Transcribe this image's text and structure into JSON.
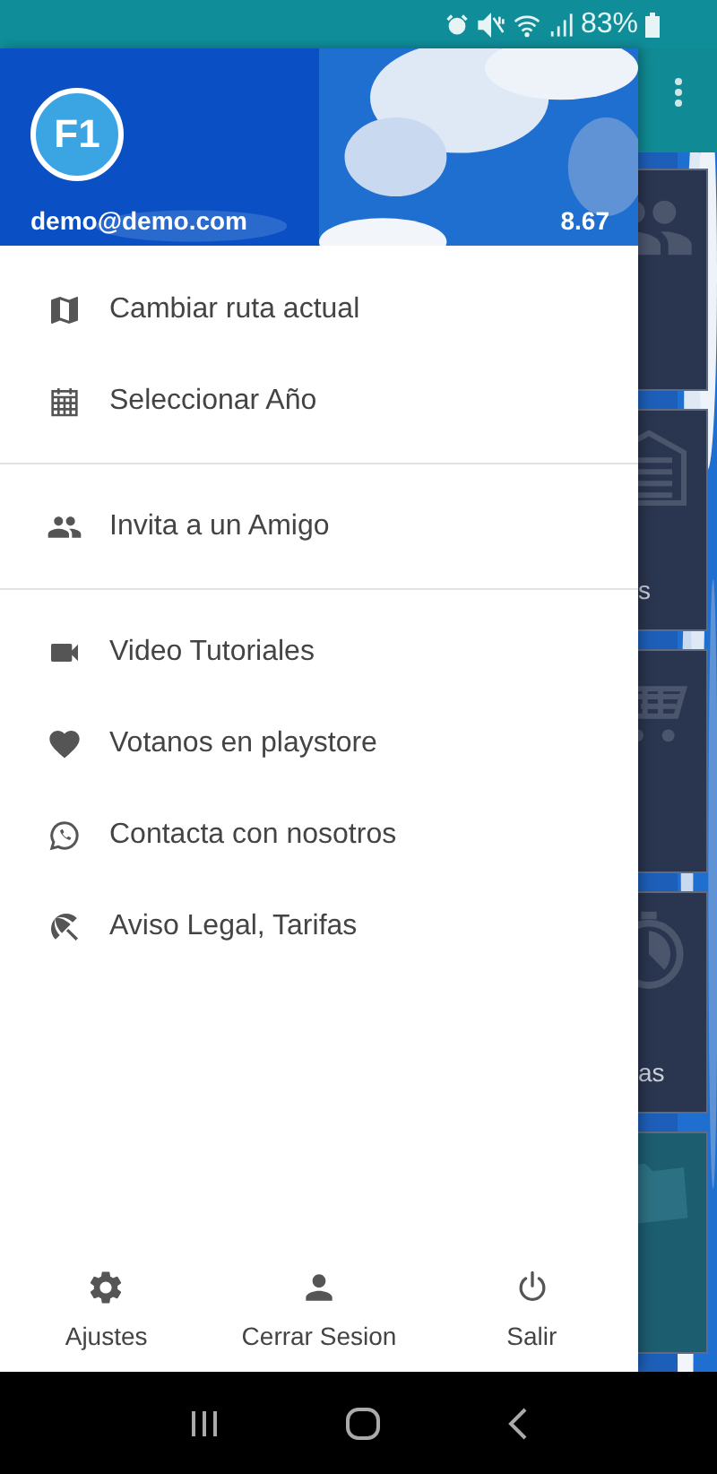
{
  "status_bar": {
    "battery_text": "83%"
  },
  "drawer": {
    "avatar": "F1",
    "email": "demo@demo.com",
    "balance": "8.67",
    "groups": [
      {
        "items": [
          {
            "kind": "map",
            "label": "Cambiar ruta actual"
          },
          {
            "kind": "calendar",
            "label": "Seleccionar Año"
          }
        ]
      },
      {
        "items": [
          {
            "kind": "people",
            "label": "Invita a un Amigo"
          }
        ]
      },
      {
        "items": [
          {
            "kind": "video",
            "label": "Video Tutoriales"
          },
          {
            "kind": "heart",
            "label": "Votanos en playstore"
          },
          {
            "kind": "chat",
            "label": "Contacta con nosotros"
          },
          {
            "kind": "umbrella",
            "label": "Aviso Legal, Tarifas"
          }
        ]
      }
    ],
    "footer": [
      {
        "kind": "settings",
        "label": "Ajustes"
      },
      {
        "kind": "person",
        "label": "Cerrar Sesion"
      },
      {
        "kind": "power",
        "label": "Salir"
      }
    ]
  },
  "background_tiles": [
    {
      "kind": "people"
    },
    {
      "kind": "building",
      "caption": "s"
    },
    {
      "kind": "cart"
    },
    {
      "kind": "stopwatch",
      "caption": "as"
    },
    {
      "kind": "folder"
    }
  ]
}
